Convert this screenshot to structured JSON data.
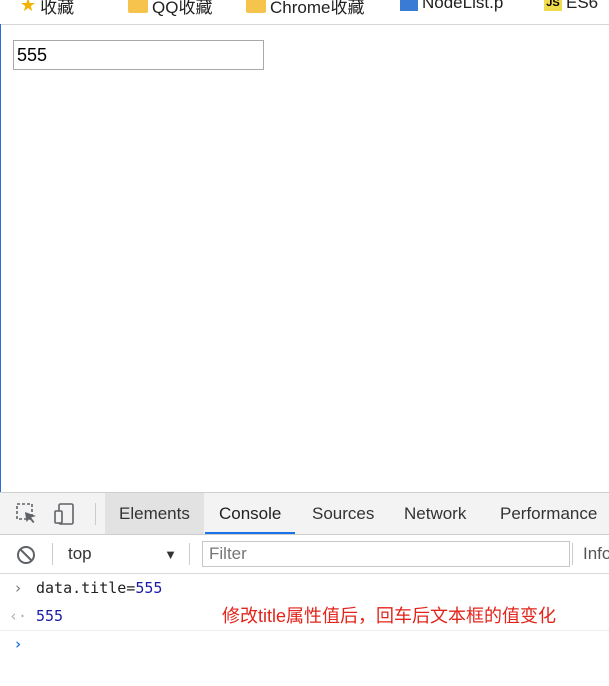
{
  "bookmarks": [
    {
      "icon": "star-icon",
      "label": "收藏"
    },
    {
      "icon": "folder-icon",
      "label": "QQ收藏"
    },
    {
      "icon": "folder-icon",
      "label": "Chrome收藏"
    },
    {
      "icon": "page-icon",
      "label": "NodeList.p"
    },
    {
      "icon": "js-icon",
      "label": "ES6"
    }
  ],
  "page": {
    "input_value": "555"
  },
  "devtools": {
    "tabs": [
      "Elements",
      "Console",
      "Sources",
      "Network",
      "Performance"
    ],
    "selected_tab": "Console",
    "console": {
      "context": "top",
      "filter_placeholder": "Filter",
      "levels_label": "Info"
    },
    "log": {
      "command_prefix": "data.title=",
      "command_value": "555",
      "result": "555"
    }
  },
  "annotation": "修改title属性值后，回车后文本框的值变化",
  "colors": {
    "accent": "#1a73e8",
    "annotation": "#e2241b",
    "console_number": "#1a1aa6"
  }
}
